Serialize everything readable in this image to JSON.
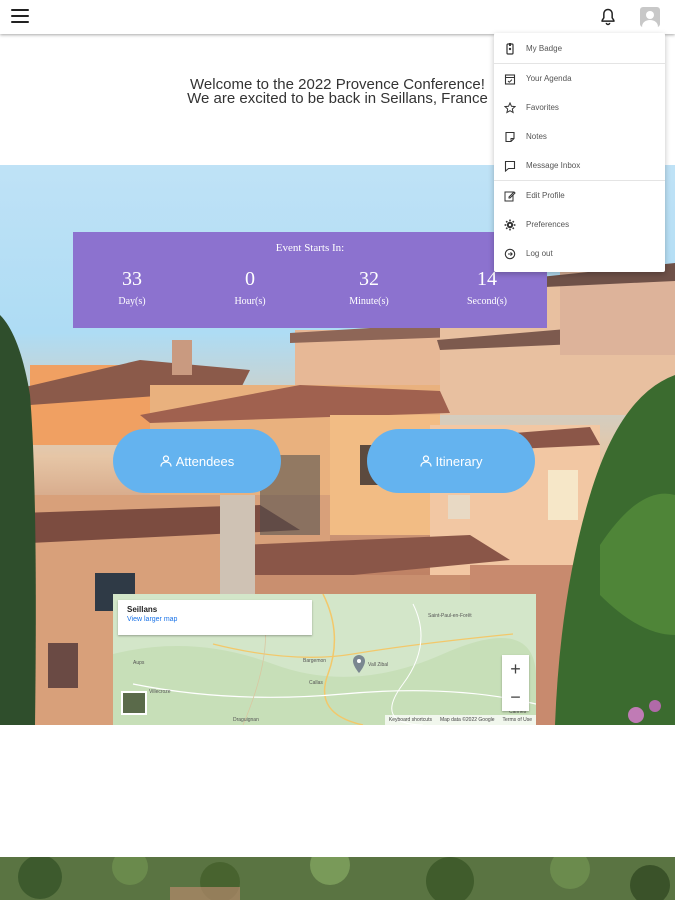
{
  "header": {
    "menu_icon": "hamburger-icon",
    "notifications_icon": "bell-icon",
    "profile_icon": "avatar-icon"
  },
  "welcome": {
    "line1": "Welcome to the 2022 Provence Conference!",
    "line2": "We are excited to be back in Seillans, France"
  },
  "countdown": {
    "title": "Event Starts In:",
    "units": [
      {
        "value": "33",
        "label": "Day(s)"
      },
      {
        "value": "0",
        "label": "Hour(s)"
      },
      {
        "value": "32",
        "label": "Minute(s)"
      },
      {
        "value": "14",
        "label": "Second(s)"
      }
    ],
    "bg_color": "#8c72cf"
  },
  "buttons": {
    "attendees": "Attendees",
    "itinerary": "Itinerary",
    "color": "#64b3ef"
  },
  "map": {
    "place": "Seillans",
    "link": "View larger map",
    "zoom_in": "+",
    "zoom_out": "−",
    "footer": [
      "Keyboard shortcuts",
      "Map data ©2022 Google",
      "Terms of Use"
    ],
    "labels": [
      "Saint-Paul-en-Forêt",
      "Bargemon",
      "Callas",
      "Aups",
      "Villecroze",
      "Draguignan",
      "Cannes"
    ],
    "pin": "Vall Zibal"
  },
  "dropdown": {
    "items": [
      {
        "label": "My Badge",
        "icon": "badge-icon"
      },
      {
        "label": "Your Agenda",
        "icon": "calendar-icon"
      },
      {
        "label": "Favorites",
        "icon": "star-icon"
      },
      {
        "label": "Notes",
        "icon": "note-icon"
      },
      {
        "label": "Message Inbox",
        "icon": "message-icon"
      },
      {
        "label": "Edit Profile",
        "icon": "edit-icon"
      },
      {
        "label": "Preferences",
        "icon": "gear-icon"
      },
      {
        "label": "Log out",
        "icon": "logout-icon"
      }
    ]
  }
}
